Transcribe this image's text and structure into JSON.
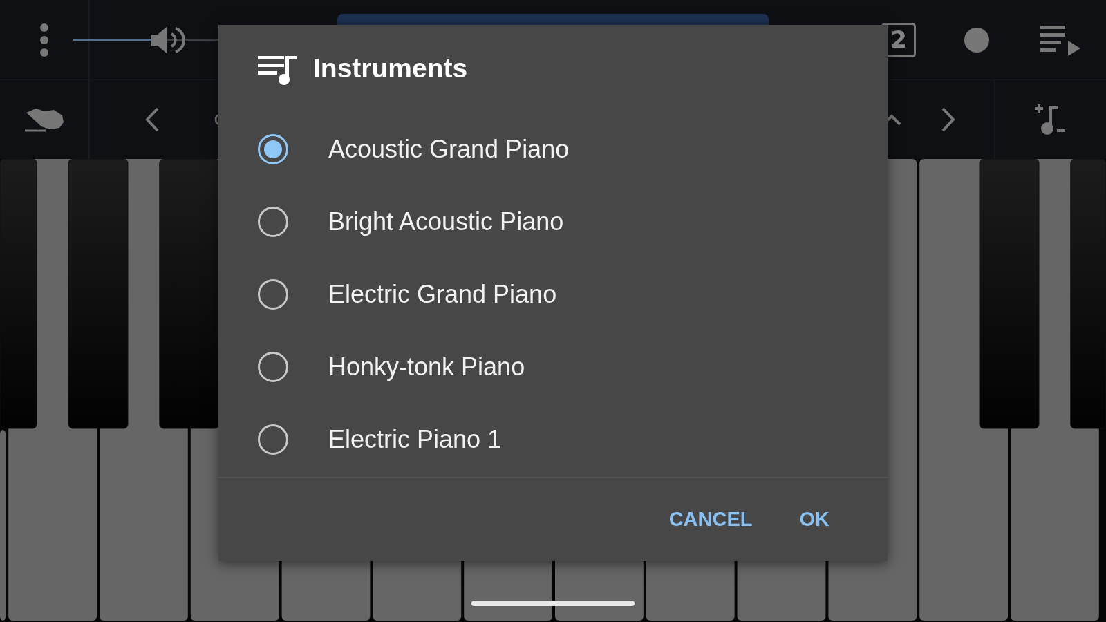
{
  "toolbar": {
    "volume": {
      "level": 0.3
    },
    "track_number": "2"
  },
  "dialog": {
    "title": "Instruments",
    "options": [
      {
        "label": "Acoustic Grand Piano",
        "selected": true
      },
      {
        "label": "Bright Acoustic Piano",
        "selected": false
      },
      {
        "label": "Electric Grand Piano",
        "selected": false
      },
      {
        "label": "Honky-tonk Piano",
        "selected": false
      },
      {
        "label": "Electric Piano 1",
        "selected": false
      }
    ],
    "buttons": [
      "CANCEL",
      "OK"
    ]
  }
}
